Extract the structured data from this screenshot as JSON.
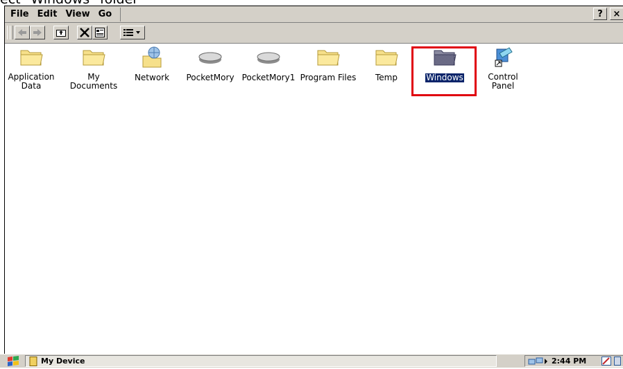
{
  "caption": "ect \"Windows\" folder",
  "menu": {
    "items": [
      {
        "label": "File"
      },
      {
        "label": "Edit"
      },
      {
        "label": "View"
      },
      {
        "label": "Go"
      }
    ],
    "help_label": "?",
    "close_label": "×"
  },
  "toolbar": {
    "back_icon": "back-arrow-icon",
    "forward_icon": "forward-arrow-icon",
    "up_icon": "up-folder-icon",
    "delete_icon": "delete-x-icon",
    "properties_icon": "properties-icon",
    "views_icon": "views-icon"
  },
  "files": [
    {
      "label": "Application\nData",
      "icon": "folder-icon"
    },
    {
      "label": "My\nDocuments",
      "icon": "folder-icon"
    },
    {
      "label": "Network",
      "icon": "network-icon"
    },
    {
      "label": "PocketMory",
      "icon": "drive-icon"
    },
    {
      "label": "PocketMory1",
      "icon": "drive-icon"
    },
    {
      "label": "Program Files",
      "icon": "folder-icon"
    },
    {
      "label": "Temp",
      "icon": "folder-icon"
    },
    {
      "label": "Windows",
      "icon": "folder-icon",
      "selected": true
    },
    {
      "label": "Control\nPanel",
      "icon": "shortcut-icon"
    }
  ],
  "taskbar": {
    "active_task": "My Device",
    "clock": "2:44 PM"
  },
  "colors": {
    "chrome": "#d4d0c8",
    "selection": "#0a246a",
    "highlight": "#e0000e",
    "folder": "#f6e08a"
  }
}
